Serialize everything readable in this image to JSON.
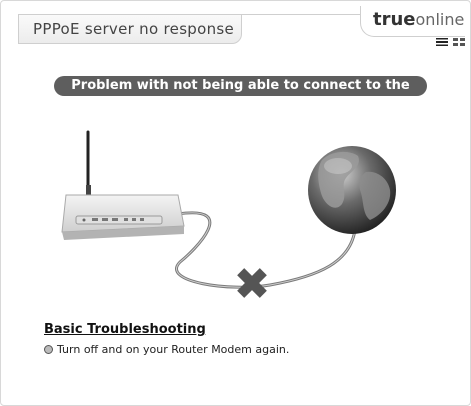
{
  "header": {
    "title": "PPPoE server no response",
    "brand_true": "true",
    "brand_online": "online"
  },
  "languages": [
    "th-flag-icon",
    "en-flag-icon"
  ],
  "banner": {
    "text": "Problem with not being able to connect to the Internet"
  },
  "illustration": {
    "router": "router-icon",
    "globe": "globe-icon",
    "status": "disconnected-x-icon"
  },
  "troubleshooting": {
    "heading": "Basic Troubleshooting",
    "steps": [
      "Turn off and on your Router Modem again."
    ]
  }
}
